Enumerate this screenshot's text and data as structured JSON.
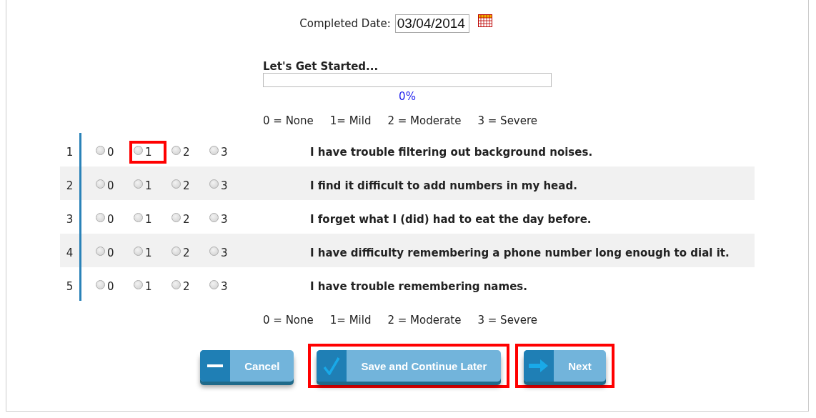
{
  "completed_date": {
    "label": "Completed Date:",
    "value": "03/04/2014"
  },
  "progress": {
    "title": "Let's Get Started...",
    "level": 0,
    "reading": "0%"
  },
  "legend_top": [
    "0 = None",
    "1= Mild",
    "2 = Moderate",
    "3 = Severe"
  ],
  "questions": [
    {
      "number": "1",
      "text": "I have trouble filtering out background noises.",
      "options": [
        {
          "label": "0",
          "selected": false,
          "highlighted": false
        },
        {
          "label": "1",
          "selected": false,
          "highlighted": true
        },
        {
          "label": "2",
          "selected": false,
          "highlighted": false
        },
        {
          "label": "3",
          "selected": false,
          "highlighted": false
        }
      ]
    },
    {
      "number": "2",
      "text": "I find it difficult to add numbers in my head.",
      "options": [
        {
          "label": "0",
          "selected": false,
          "highlighted": false
        },
        {
          "label": "1",
          "selected": false,
          "highlighted": false
        },
        {
          "label": "2",
          "selected": false,
          "highlighted": false
        },
        {
          "label": "3",
          "selected": false,
          "highlighted": false
        }
      ]
    },
    {
      "number": "3",
      "text": "I forget what I (did) had to eat the day before.",
      "options": [
        {
          "label": "0",
          "selected": false,
          "highlighted": false
        },
        {
          "label": "1",
          "selected": false,
          "highlighted": false
        },
        {
          "label": "2",
          "selected": false,
          "highlighted": false
        },
        {
          "label": "3",
          "selected": false,
          "highlighted": false
        }
      ]
    },
    {
      "number": "4",
      "text": "I have difficulty remembering a phone number long enough to dial it.",
      "options": [
        {
          "label": "0",
          "selected": false,
          "highlighted": false
        },
        {
          "label": "1",
          "selected": false,
          "highlighted": false
        },
        {
          "label": "2",
          "selected": false,
          "highlighted": false
        },
        {
          "label": "3",
          "selected": false,
          "highlighted": false
        }
      ]
    },
    {
      "number": "5",
      "text": "I have trouble remembering names.",
      "options": [
        {
          "label": "0",
          "selected": false,
          "highlighted": false
        },
        {
          "label": "1",
          "selected": false,
          "highlighted": false
        },
        {
          "label": "2",
          "selected": false,
          "highlighted": false
        },
        {
          "label": "3",
          "selected": false,
          "highlighted": false
        }
      ]
    }
  ],
  "legend_bottom": [
    "0 = None",
    "1= Mild",
    "2 = Moderate",
    "3 = Severe"
  ],
  "buttons": [
    {
      "label": "Cancel",
      "kind": "minus",
      "highlighted": false
    },
    {
      "label": "Save and Continue Later",
      "kind": "check",
      "highlighted": true
    },
    {
      "label": "Next",
      "kind": "arrow",
      "highlighted": true
    }
  ]
}
